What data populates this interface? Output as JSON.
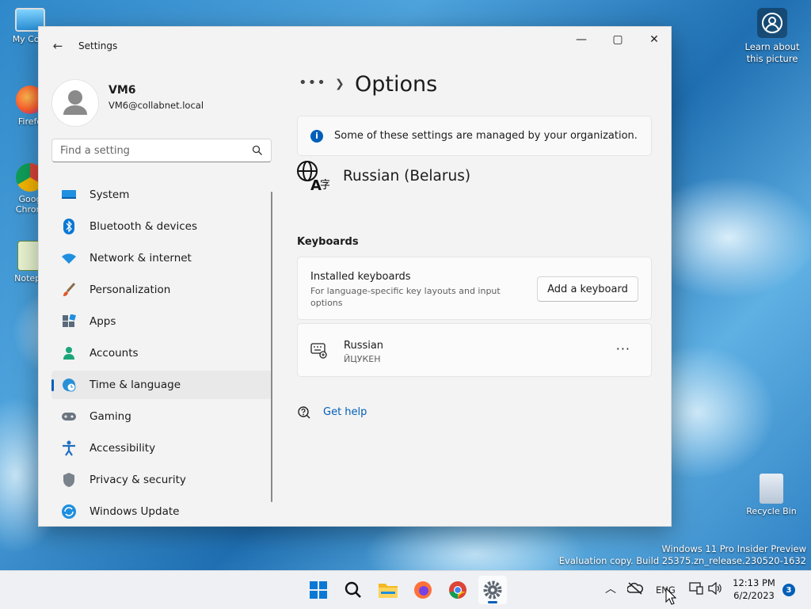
{
  "desktop": {
    "icons": [
      {
        "label": "My Com"
      },
      {
        "label": "Firefo"
      },
      {
        "label": "Goog Chrom"
      },
      {
        "label": "Notepa"
      },
      {
        "label": "Recycle Bin"
      }
    ],
    "learn_label": "Learn about this picture",
    "watermark_line1": "Windows 11 Pro Insider Preview",
    "watermark_line2": "Evaluation copy. Build 25375.zn_release.230520-1632"
  },
  "window": {
    "title": "Settings",
    "controls": {
      "minimize": "—",
      "maximize": "▢",
      "close": "✕"
    }
  },
  "user": {
    "name": "VM6",
    "email": "VM6@collabnet.local"
  },
  "search": {
    "placeholder": "Find a setting"
  },
  "nav": {
    "items": [
      {
        "label": "System",
        "icon": "monitor-icon"
      },
      {
        "label": "Bluetooth & devices",
        "icon": "bluetooth-icon"
      },
      {
        "label": "Network & internet",
        "icon": "wifi-icon"
      },
      {
        "label": "Personalization",
        "icon": "brush-icon"
      },
      {
        "label": "Apps",
        "icon": "apps-icon"
      },
      {
        "label": "Accounts",
        "icon": "person-icon"
      },
      {
        "label": "Time & language",
        "icon": "globe-clock-icon",
        "active": true
      },
      {
        "label": "Gaming",
        "icon": "gamepad-icon"
      },
      {
        "label": "Accessibility",
        "icon": "accessibility-icon"
      },
      {
        "label": "Privacy & security",
        "icon": "shield-icon"
      },
      {
        "label": "Windows Update",
        "icon": "update-icon"
      }
    ]
  },
  "main": {
    "breadcrumb_more": "•••",
    "title": "Options",
    "managed_banner": "Some of these settings are managed by your organization.",
    "language_name": "Russian (Belarus)",
    "keyboards_header": "Keyboards",
    "installed": {
      "title": "Installed keyboards",
      "subtitle": "For language-specific key layouts and input options",
      "add_button": "Add a keyboard"
    },
    "keyboard": {
      "name": "Russian",
      "layout": "ЙЦУКЕН",
      "more": "···"
    },
    "help_link": "Get help"
  },
  "taskbar": {
    "lang": "ENG",
    "time": "12:13 PM",
    "date": "6/2/2023",
    "notifications": "3"
  },
  "colors": {
    "accent": "#005fb8"
  }
}
